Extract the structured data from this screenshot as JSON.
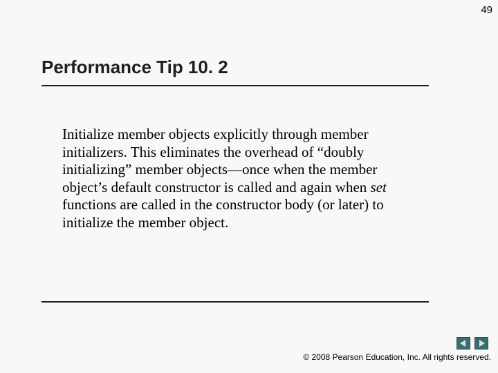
{
  "page_number": "49",
  "title": "Performance Tip 10. 2",
  "body": {
    "pre": "Initialize member objects explicitly through member initializers. This eliminates the overhead of “doubly initializing” member objects—once when the member object’s default constructor is called and again when ",
    "ital": "set",
    "post": " functions are called in the constructor body (or later) to initialize the member object."
  },
  "copyright": "© 2008 Pearson Education, Inc.  All rights reserved.",
  "nav": {
    "prev": "previous-slide",
    "next": "next-slide"
  }
}
